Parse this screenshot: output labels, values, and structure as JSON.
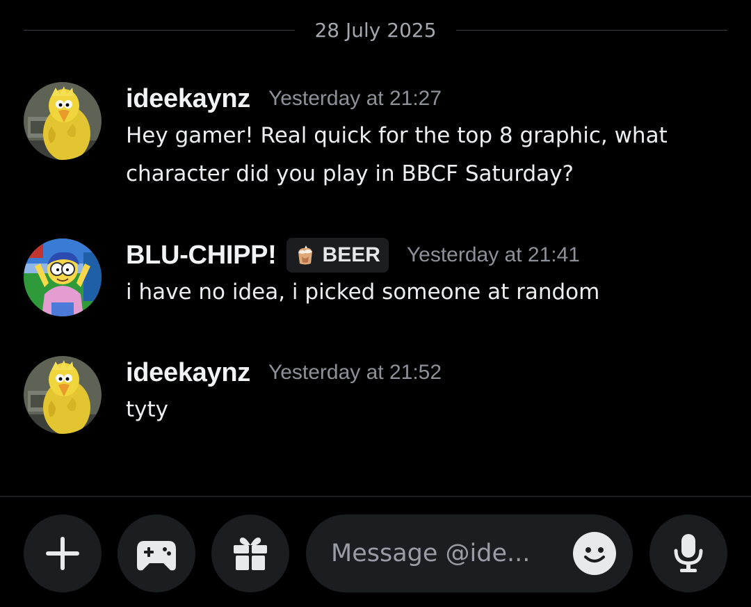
{
  "date_divider": {
    "label": "28 July 2025"
  },
  "messages": [
    {
      "username": "ideekaynz",
      "timestamp": "Yesterday at 21:27",
      "lines": [
        "Hey gamer! Real quick for the top 8 graphic, what",
        "character did you play in BBCF Saturday?"
      ],
      "avatar": "big-bird-avatar"
    },
    {
      "username": "BLU-CHIPP!",
      "tag": {
        "icon": "beer-clan-icon",
        "label": "BEER"
      },
      "timestamp": "Yesterday at 21:41",
      "lines": [
        "i have no idea, i picked someone at random"
      ],
      "avatar": "milhouse-avatar"
    },
    {
      "username": "ideekaynz",
      "timestamp": "Yesterday at 21:52",
      "lines": [
        "tyty"
      ],
      "avatar": "big-bird-avatar"
    }
  ],
  "composer": {
    "placeholder": "Message @ide...",
    "buttons": [
      "plus-icon",
      "gamepad-icon",
      "gift-icon",
      "emoji-icon",
      "microphone-icon"
    ]
  },
  "colors": {
    "background": "#000000",
    "surface": "#1c1d21",
    "text_primary": "#f2f3f5",
    "text_muted": "#8e9199"
  }
}
